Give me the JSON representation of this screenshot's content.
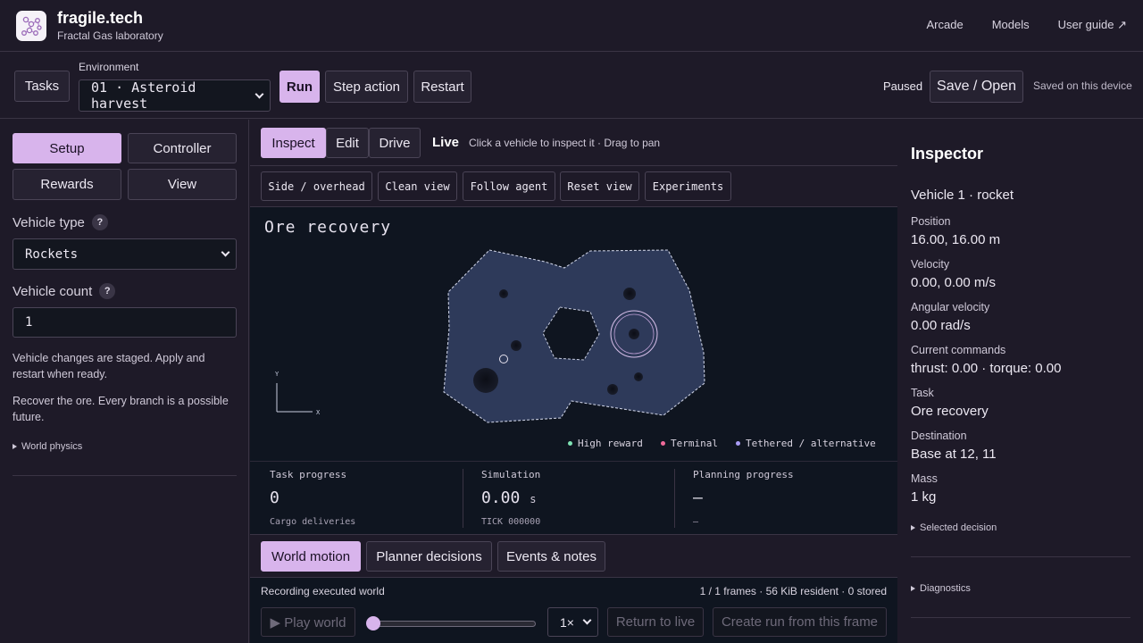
{
  "header": {
    "brand": "fragile.tech",
    "subtitle": "Fractal Gas laboratory",
    "nav": [
      "Arcade",
      "Models",
      "User guide ↗"
    ]
  },
  "toolbar": {
    "tasks_label": "Tasks",
    "environment_label": "Environment",
    "environment_value": "01 · Asteroid harvest",
    "run_label": "Run",
    "step_label": "Step action",
    "restart_label": "Restart",
    "status": "Paused",
    "save_label": "Save / Open",
    "saved_note": "Saved on this device"
  },
  "sidebar": {
    "tabs": [
      "Setup",
      "Controller",
      "Rewards",
      "View"
    ],
    "active_tab": "Setup",
    "vehicle_type_label": "Vehicle type",
    "vehicle_type_value": "Rockets",
    "vehicle_count_label": "Vehicle count",
    "vehicle_count_value": "1",
    "help_glyph": "?",
    "note1": "Vehicle changes are staged. Apply and restart when ready.",
    "note2": "Recover the ore. Every branch is a possible future.",
    "world_physics": "World physics"
  },
  "center": {
    "modes": [
      "Inspect",
      "Edit",
      "Drive"
    ],
    "active_mode": "Inspect",
    "live_label": "Live",
    "hint": "Click a vehicle to inspect it · Drag to pan",
    "view_buttons": [
      "Side / overhead",
      "Clean view",
      "Follow agent",
      "Reset view",
      "Experiments"
    ],
    "scene_title": "Ore recovery",
    "axis_y": "Y",
    "axis_x": "X",
    "legend": [
      {
        "label": "High reward",
        "color": "#7fe3b4"
      },
      {
        "label": "Terminal",
        "color": "#f06a9a"
      },
      {
        "label": "Tethered / alternative",
        "color": "#a99cf5"
      }
    ],
    "stats": [
      {
        "title": "Task progress",
        "value": "0",
        "unit": "",
        "sub": "Cargo deliveries"
      },
      {
        "title": "Simulation",
        "value": "0.00",
        "unit": "s",
        "sub": "TICK 000000"
      },
      {
        "title": "Planning progress",
        "value": "—",
        "unit": "",
        "sub": "—"
      }
    ],
    "bottom_tabs": [
      "World motion",
      "Planner decisions",
      "Events & notes"
    ],
    "active_bottom_tab": "World motion",
    "recording_label": "Recording executed world",
    "recording_info": "1 / 1 frames · 56 KiB resident · 0 stored",
    "play_label": "▶ Play world",
    "speed_value": "1×",
    "return_label": "Return to live",
    "create_label": "Create run from this frame",
    "timeline_position": 0
  },
  "inspector": {
    "title": "Inspector",
    "subject": "Vehicle 1 · rocket",
    "fields": [
      {
        "key": "Position",
        "value": "16.00, 16.00 m"
      },
      {
        "key": "Velocity",
        "value": "0.00, 0.00 m/s"
      },
      {
        "key": "Angular velocity",
        "value": "0.00 rad/s"
      },
      {
        "key": "Current commands",
        "value": "thrust: 0.00 · torque: 0.00"
      },
      {
        "key": "Task",
        "value": "Ore recovery"
      },
      {
        "key": "Destination",
        "value": "Base at 12, 11"
      },
      {
        "key": "Mass",
        "value": "1 kg"
      }
    ],
    "selected_decision": "Selected decision",
    "diagnostics": "Diagnostics"
  },
  "colors": {
    "accent": "#d8b4ec",
    "background": "#1e1a28",
    "canvas": "#0f1520",
    "terrain": "#2e3a5a"
  }
}
